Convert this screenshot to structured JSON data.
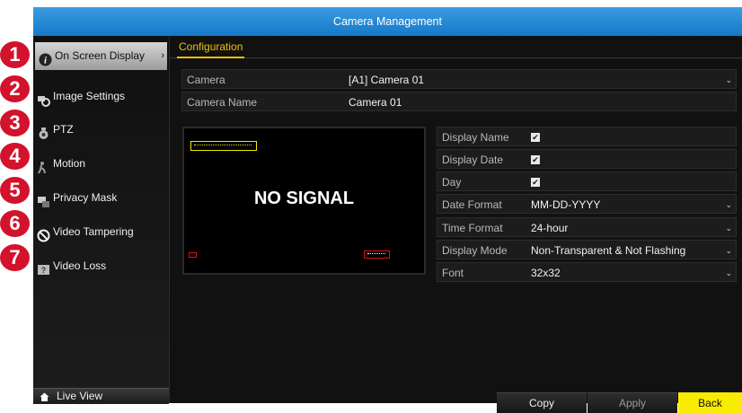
{
  "window": {
    "title": "Camera Management"
  },
  "sidebar": {
    "items": [
      {
        "label": "On Screen Display",
        "icon": "info-icon",
        "active": true
      },
      {
        "label": "Image Settings",
        "icon": "image-settings-icon"
      },
      {
        "label": "PTZ",
        "icon": "ptz-camera-icon"
      },
      {
        "label": "Motion",
        "icon": "motion-icon"
      },
      {
        "label": "Privacy Mask",
        "icon": "privacy-mask-icon"
      },
      {
        "label": "Video Tampering",
        "icon": "video-tampering-icon"
      },
      {
        "label": "Video Loss",
        "icon": "video-loss-icon"
      }
    ],
    "live_view": "Live View"
  },
  "badges": [
    "1",
    "2",
    "3",
    "4",
    "5",
    "6",
    "7"
  ],
  "content": {
    "tab": "Configuration",
    "camera_label": "Camera",
    "camera_value": "[A1] Camera 01",
    "camera_name_label": "Camera Name",
    "camera_name_value": "Camera 01",
    "preview_text": "NO SIGNAL",
    "settings": [
      {
        "label": "Display Name",
        "type": "checkbox",
        "checked": true
      },
      {
        "label": "Display Date",
        "type": "checkbox",
        "checked": true
      },
      {
        "label": "Day",
        "type": "checkbox",
        "checked": true
      },
      {
        "label": "Date Format",
        "type": "select",
        "value": "MM-DD-YYYY"
      },
      {
        "label": "Time Format",
        "type": "select",
        "value": "24-hour"
      },
      {
        "label": "Display Mode",
        "type": "select",
        "value": "Non-Transparent & Not Flashing"
      },
      {
        "label": "Font",
        "type": "select",
        "value": "32x32"
      }
    ]
  },
  "buttons": {
    "copy": "Copy",
    "apply": "Apply",
    "back": "Back"
  },
  "colors": {
    "title_bar": "#1a82d4",
    "accent": "#f2c100",
    "back_button": "#f7ec00",
    "badge": "#d3122b"
  }
}
